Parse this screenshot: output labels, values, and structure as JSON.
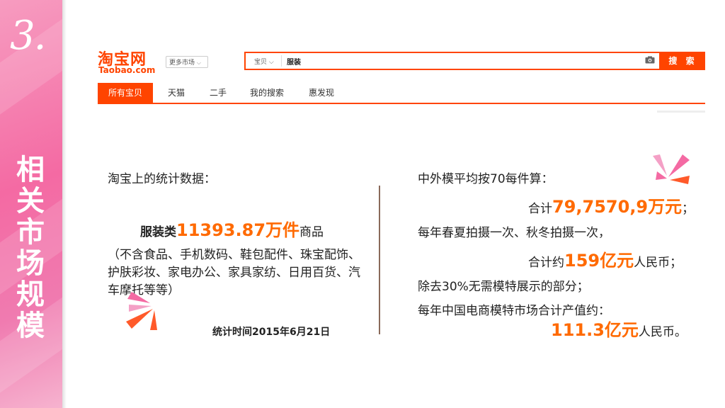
{
  "slide": {
    "number": "3.",
    "title": "相关市场规模"
  },
  "taobao": {
    "logo_cn": "淘宝网",
    "logo_en": "Taobao.com",
    "market_dropdown": "更多市场",
    "search_scope": "宝贝",
    "search_value": "服装",
    "search_button": "搜 索",
    "tabs": [
      "所有宝贝",
      "天猫",
      "二手",
      "我的搜索",
      "惠发现"
    ]
  },
  "left": {
    "heading": "淘宝上的统计数据：",
    "stat_prefix": "服装类",
    "stat_value": "11393.87万件",
    "stat_suffix": "商品",
    "note": "（不含食品、手机数码、鞋包配件、珠宝配饰、护肤彩妆、家电办公、家具家纺、日用百货、汽车摩托等等）",
    "date": "统计时间2015年6月21日"
  },
  "right": {
    "line1": "中外模平均按70每件算：",
    "line2_prefix": "合计",
    "line2_value": "79,7570,9万元",
    "line2_suffix": "；",
    "line3": "每年春夏拍摄一次、秋冬拍摄一次，",
    "line4_prefix": "合计约",
    "line4_value": "159亿元",
    "line4_suffix": "人民币；",
    "line5": "除去30%无需模特展示的部分；",
    "line6": "每年中国电商模特市场合计产值约：",
    "line7_value": "111.3亿元",
    "line7_suffix": "人民币。"
  },
  "colors": {
    "accent": "#ff4400",
    "highlight": "#ff6a00",
    "sidebar": "#f46aa3"
  }
}
